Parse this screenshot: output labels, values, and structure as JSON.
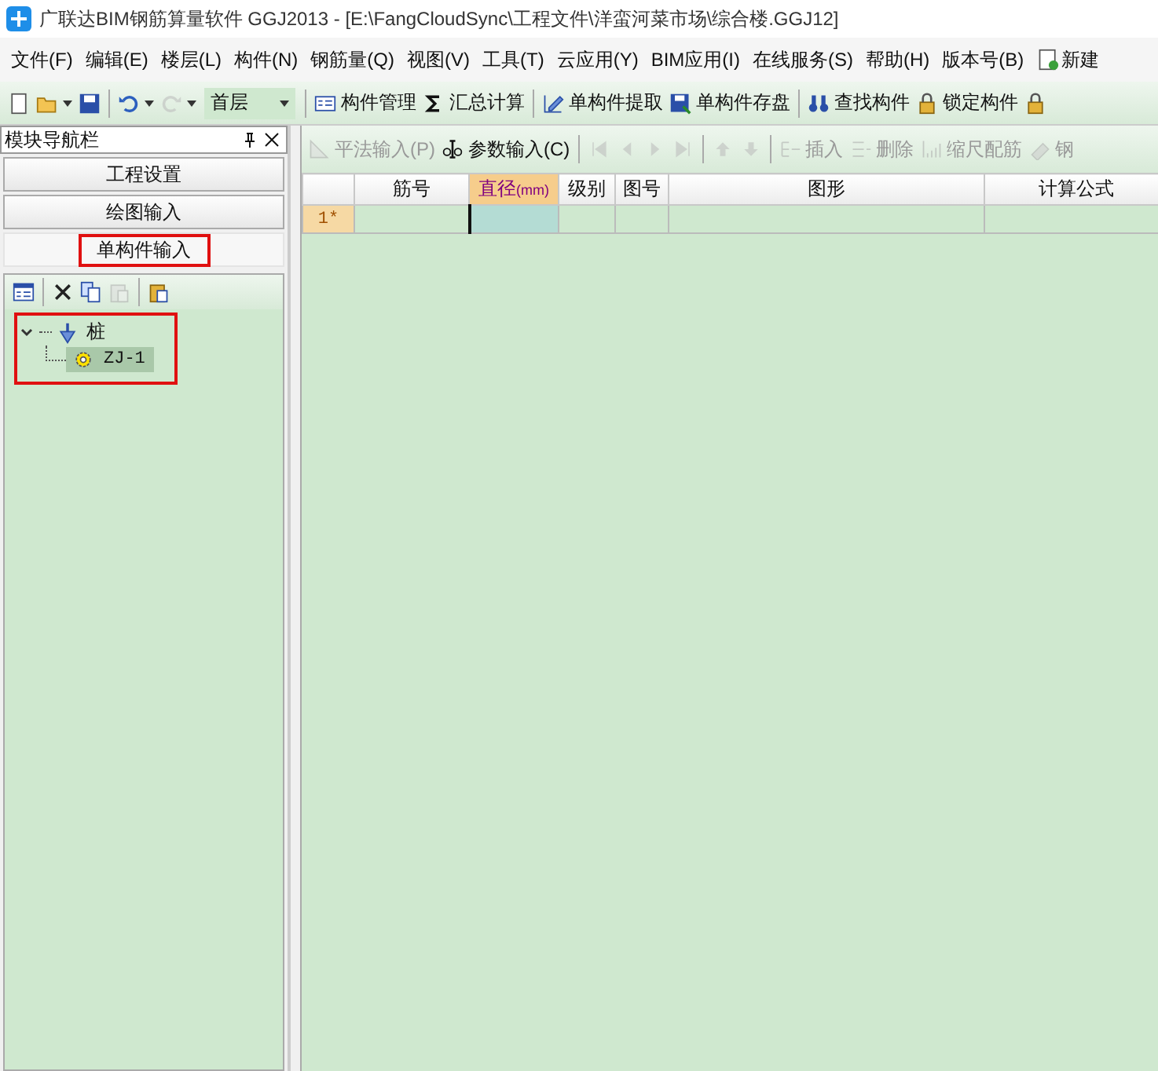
{
  "window": {
    "title": "广联达BIM钢筋算量软件 GGJ2013 - [E:\\FangCloudSync\\工程文件\\洋蛮河菜市场\\综合楼.GGJ12]"
  },
  "menu": [
    {
      "label": "文件(F)",
      "kind": "text"
    },
    {
      "label": "编辑(E)",
      "kind": "text"
    },
    {
      "label": "楼层(L)",
      "kind": "text"
    },
    {
      "label": "构件(N)",
      "kind": "text"
    },
    {
      "label": "钢筋量(Q)",
      "kind": "text"
    },
    {
      "label": "视图(V)",
      "kind": "text"
    },
    {
      "label": "工具(T)",
      "kind": "text"
    },
    {
      "label": "云应用(Y)",
      "kind": "text"
    },
    {
      "label": "BIM应用(I)",
      "kind": "text"
    },
    {
      "label": "在线服务(S)",
      "kind": "text"
    },
    {
      "label": "帮助(H)",
      "kind": "text"
    },
    {
      "label": "版本号(B)",
      "kind": "text"
    },
    {
      "label": "新建",
      "kind": "icon-item"
    }
  ],
  "toolbar": [
    {
      "kind": "icon",
      "dropdown": false
    },
    {
      "kind": "icon",
      "dropdown": true
    },
    {
      "kind": "icon",
      "dropdown": false
    },
    {
      "kind": "sep"
    },
    {
      "kind": "icon",
      "dropdown": true,
      "disabled": false
    },
    {
      "kind": "icon",
      "dropdown": true,
      "disabled": true
    },
    {
      "kind": "select",
      "value": "首层"
    },
    {
      "kind": "sep"
    },
    {
      "kind": "button",
      "label": "构件管理"
    },
    {
      "kind": "button",
      "label": "汇总计算"
    },
    {
      "kind": "sep"
    },
    {
      "kind": "button",
      "label": "单构件提取"
    },
    {
      "kind": "button",
      "label": "单构件存盘"
    },
    {
      "kind": "sep"
    },
    {
      "kind": "button",
      "label": "查找构件"
    },
    {
      "kind": "button",
      "label": "锁定构件"
    },
    {
      "kind": "icon",
      "dropdown": false
    }
  ],
  "nav_panel": {
    "title": "模块导航栏",
    "sections": [
      {
        "label": "工程设置",
        "selected": false,
        "highlighted": false
      },
      {
        "label": "绘图输入",
        "selected": false,
        "highlighted": false
      },
      {
        "label": "单构件输入",
        "selected": true,
        "highlighted": true
      }
    ],
    "tools": [
      {
        "kind": "button",
        "disabled": false
      },
      {
        "kind": "sep"
      },
      {
        "kind": "button",
        "disabled": false
      },
      {
        "kind": "button",
        "disabled": false
      },
      {
        "kind": "button",
        "disabled": true
      },
      {
        "kind": "sep"
      },
      {
        "kind": "button",
        "disabled": false
      }
    ],
    "tree_highlighted": true,
    "tree": [
      {
        "label": "桩",
        "expanded": true,
        "children": [
          {
            "label": "ZJ-1",
            "selected": true
          }
        ]
      }
    ]
  },
  "grid_toolbar": [
    {
      "kind": "button",
      "label": "平法输入(P)",
      "disabled": true
    },
    {
      "kind": "button",
      "label": "参数输入(C)",
      "disabled": false
    },
    {
      "kind": "sep"
    },
    {
      "kind": "button",
      "disabled": true
    },
    {
      "kind": "button",
      "disabled": true
    },
    {
      "kind": "button",
      "disabled": true
    },
    {
      "kind": "button",
      "disabled": true
    },
    {
      "kind": "sep"
    },
    {
      "kind": "button",
      "disabled": true
    },
    {
      "kind": "button",
      "disabled": true
    },
    {
      "kind": "sep"
    },
    {
      "kind": "button",
      "label": "插入",
      "disabled": true
    },
    {
      "kind": "button",
      "label": "删除",
      "disabled": true
    },
    {
      "kind": "button",
      "label": "缩尺配筋",
      "disabled": true
    },
    {
      "kind": "button",
      "label": "钢",
      "disabled": true
    }
  ],
  "table": {
    "columns": [
      {
        "label": "筋号",
        "selected": false
      },
      {
        "label": "直径$_{(mm)}$",
        "selected": true
      },
      {
        "label": "级别",
        "selected": false
      },
      {
        "label": "图号",
        "selected": false
      },
      {
        "label": "图形",
        "selected": false
      },
      {
        "label": "计算公式",
        "selected": false
      }
    ],
    "rows": [
      {
        "label": "1*",
        "selected": true
      }
    ]
  }
}
